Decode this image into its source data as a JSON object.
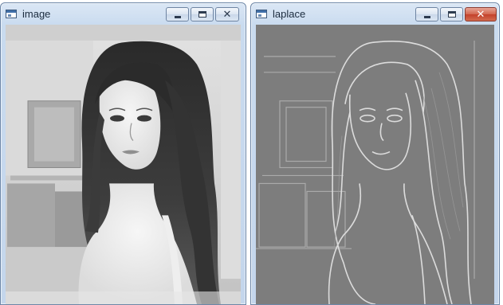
{
  "windows": [
    {
      "title": "image",
      "icon": "opencv-window-icon",
      "controls": [
        "minimize",
        "maximize",
        "close"
      ],
      "content": "grayscale illustration of woman with long dark hair"
    },
    {
      "title": "laplace",
      "icon": "opencv-window-icon",
      "controls": [
        "minimize",
        "maximize",
        "close"
      ],
      "content": "laplacian edge filtered version of the image"
    }
  ],
  "controls": {
    "minimize_glyph": "",
    "maximize_glyph": "",
    "close_glyph": "✕"
  },
  "colors": {
    "titlebar": "#c9dbef",
    "close_active": "#c4412b"
  }
}
